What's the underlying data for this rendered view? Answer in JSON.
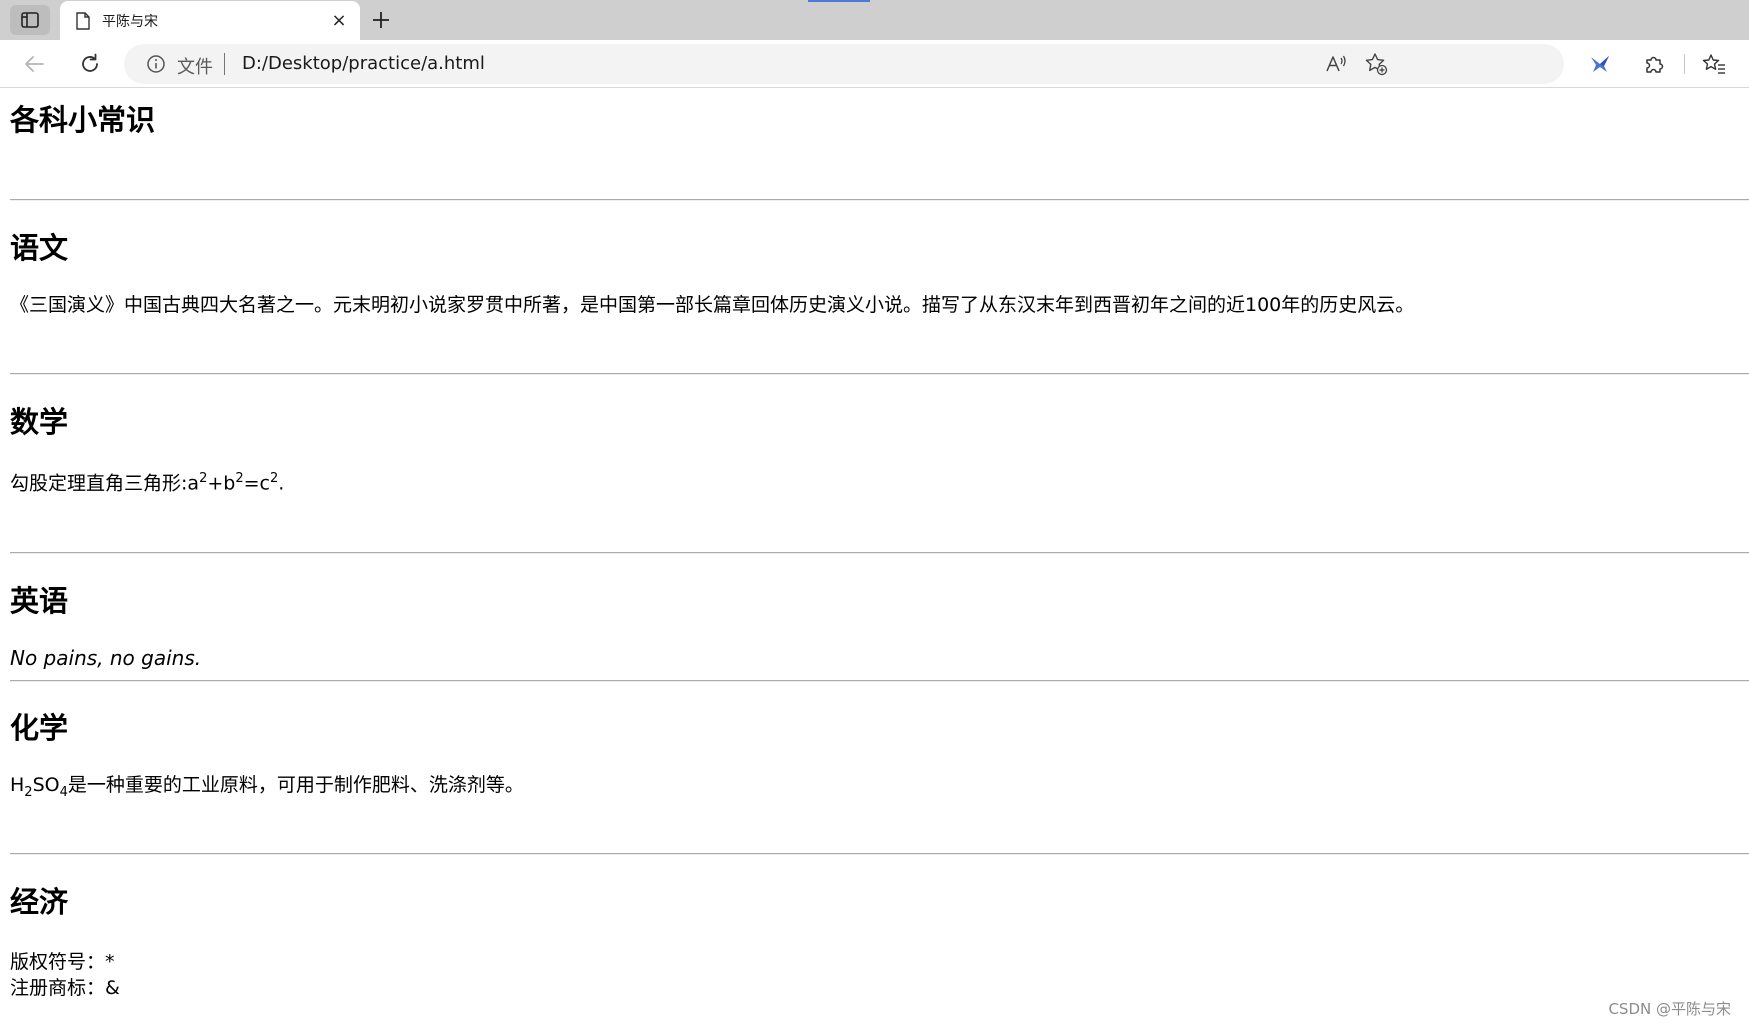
{
  "browser": {
    "tab": {
      "title": "平陈与宋",
      "close_glyph": "×",
      "new_tab_glyph": "+"
    },
    "address": {
      "scheme_label": "文件",
      "url": "D:/Desktop/practice/a.html"
    },
    "icons": [
      "tab-actions-icon",
      "page-icon",
      "close-icon",
      "plus-icon",
      "back-arrow-icon",
      "refresh-icon",
      "info-icon",
      "read-aloud-icon",
      "add-favorite-icon",
      "extension-bird-icon",
      "puzzle-icon",
      "favorites-icon"
    ]
  },
  "page": {
    "title": "各科小常识",
    "sections": {
      "chinese": {
        "heading": "语文",
        "text": "《三国演义》中国古典四大名著之一。元末明初小说家罗贯中所著，是中国第一部长篇章回体历史演义小说。描写了从东汉末年到西晋初年之间的近100年的历史风云。"
      },
      "math": {
        "heading": "数学",
        "prefix": "勾股定理直角三角形:",
        "a": "a",
        "b": "b",
        "c": "c",
        "exp": "2",
        "plus": "+",
        "equals": "=",
        "end": "."
      },
      "english": {
        "heading": "英语",
        "text": "No pains, no gains."
      },
      "chemistry": {
        "heading": "化学",
        "h": "H",
        "sub1": "2",
        "so": "SO",
        "sub2": "4",
        "rest": "是一种重要的工业原料，可用于制作肥料、洗涤剂等。"
      },
      "economy": {
        "heading": "经济",
        "line1": "版权符号：*",
        "line2": "注册商标：&"
      }
    },
    "watermark": "CSDN @平陈与宋"
  }
}
